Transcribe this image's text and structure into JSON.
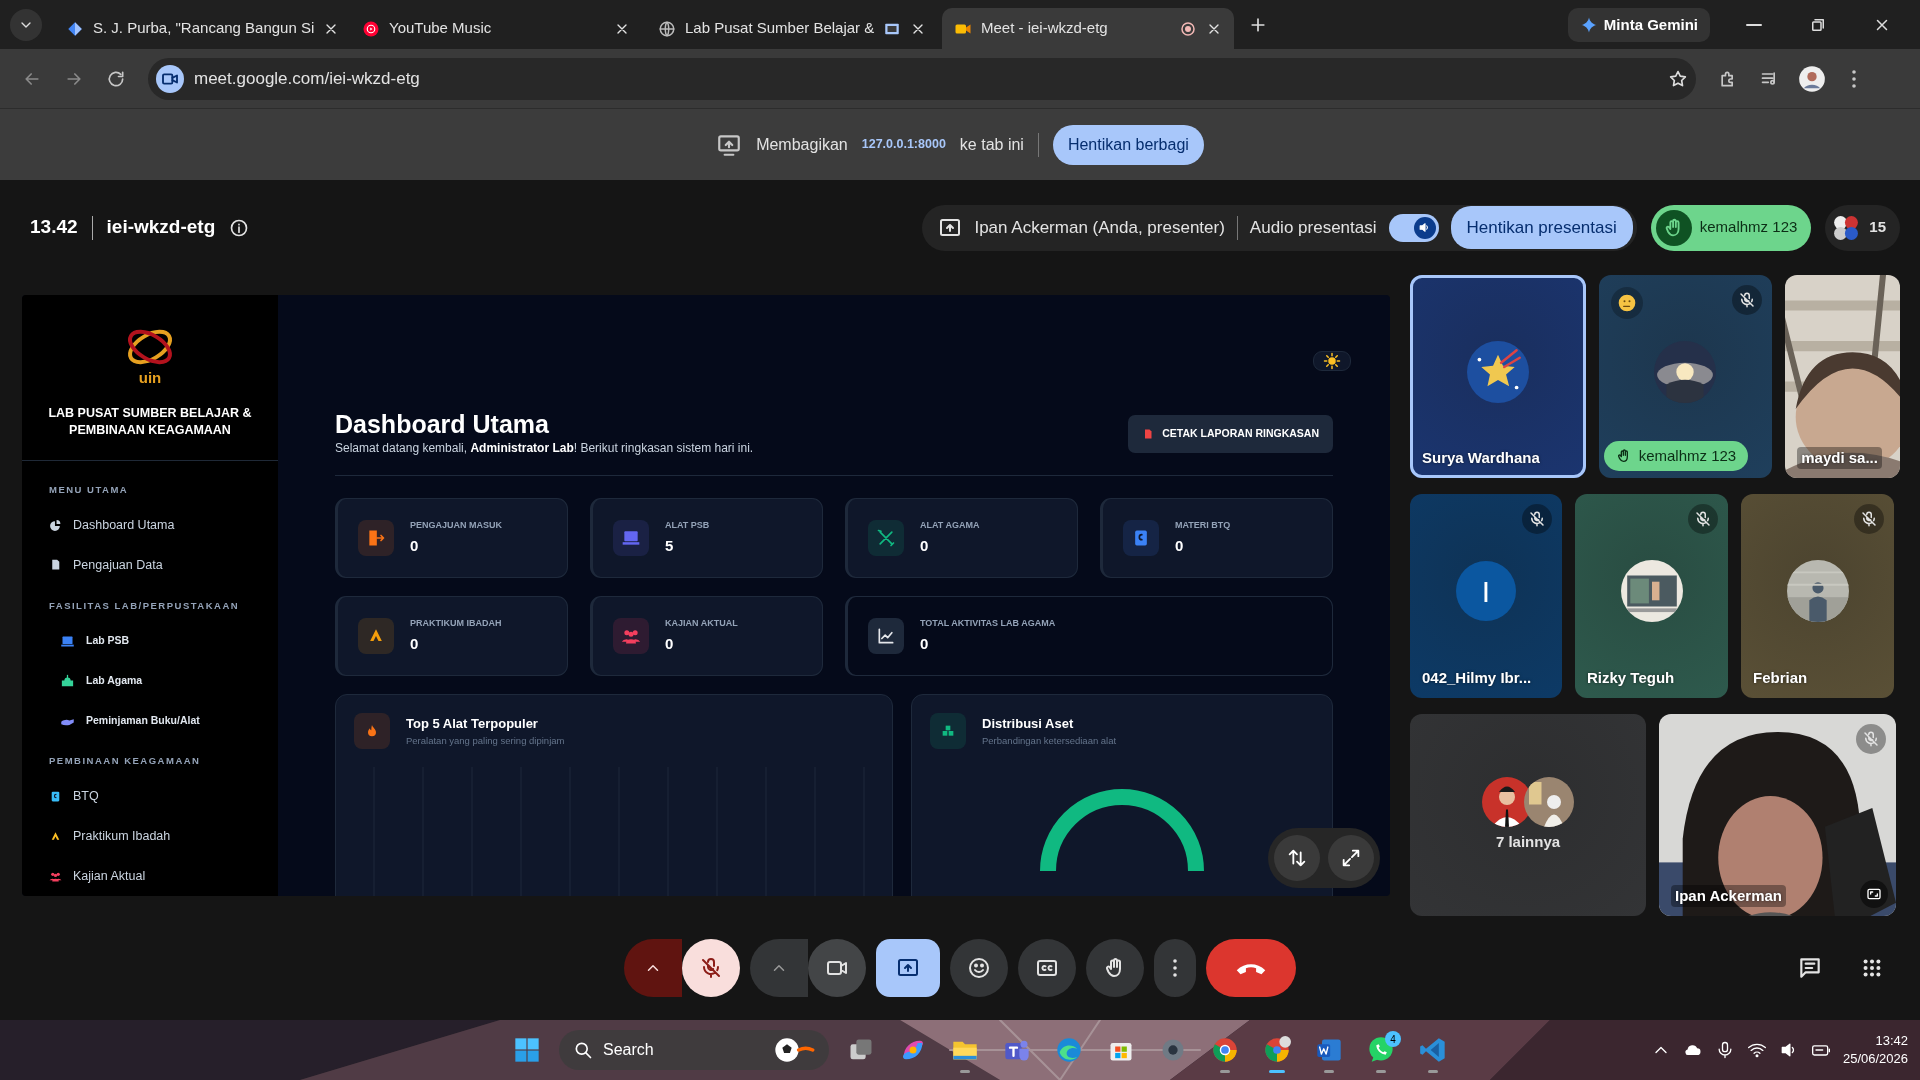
{
  "browser": {
    "tabs": [
      {
        "title": "S. J. Purba, \"Rancang Bangun Si",
        "kind": "doc",
        "selected": false,
        "being_shared": false,
        "recording": false
      },
      {
        "title": "YouTube Music",
        "kind": "music",
        "selected": false,
        "being_shared": false,
        "recording": false
      },
      {
        "title": "Lab Pusat Sumber Belajar &",
        "kind": "web",
        "selected": false,
        "being_shared": true,
        "recording": false
      },
      {
        "title": "Meet - iei-wkzd-etg",
        "kind": "meet",
        "selected": true,
        "being_shared": false,
        "recording": true
      }
    ],
    "gemini_button": "Minta Gemini",
    "address": "meet.google.com/iei-wkzd-etg"
  },
  "share_banner": {
    "label": "Membagikan",
    "origin": "127.0.0.1:8000",
    "suffix": "ke tab ini",
    "button": "Hentikan berbagi"
  },
  "meeting": {
    "time": "13.42",
    "code": "iei-wkzd-etg",
    "presenter": "Ipan Ackerman (Anda, presenter)",
    "audio_label": "Audio presentasi",
    "audio_on": true,
    "stop_button": "Hentikan presentasi",
    "raised_hand": "kemalhmz 123",
    "participant_count": "15"
  },
  "shared_screen": {
    "sidebar": {
      "logo_text": "uin",
      "brand": "LAB PUSAT SUMBER BELAJAR & PEMBINAAN KEAGAMAAN",
      "sections": [
        {
          "title": "MENU UTAMA",
          "items": [
            {
              "label": "Dashboard Utama",
              "kind": "main",
              "color": "#cbd5e1"
            },
            {
              "label": "Pengajuan Data",
              "kind": "main",
              "color": "#cbd5e1"
            }
          ]
        },
        {
          "title": "FASILITAS LAB/PERPUSTAKAAN",
          "items": [
            {
              "label": "Lab PSB",
              "kind": "sub",
              "color": "#3b82f6"
            },
            {
              "label": "Lab Agama",
              "kind": "sub",
              "color": "#34d399"
            },
            {
              "label": "Peminjaman Buku/Alat",
              "kind": "sub",
              "color": "#818cf8"
            }
          ]
        },
        {
          "title": "PEMBINAAN KEAGAMAAN",
          "items": [
            {
              "label": "BTQ",
              "kind": "main",
              "color": "#38bdf8"
            },
            {
              "label": "Praktikum Ibadah",
              "kind": "main",
              "color": "#fbbf24"
            },
            {
              "label": "Kajian Aktual",
              "kind": "main",
              "color": "#f43f5e"
            }
          ]
        }
      ]
    },
    "dashboard": {
      "title": "Dashboard Utama",
      "subtitle": "Selamat datang kembali, **Administrator Lab**! Berikut ringkasan sistem hari ini.",
      "print_button": "CETAK LAPORAN RINGKASAN",
      "stats": [
        {
          "label": "PENGAJUAN MASUK",
          "value": "0",
          "kind": "small",
          "color": "#f97316"
        },
        {
          "label": "ALAT PSB",
          "value": "5",
          "kind": "small",
          "color": "#6366f1"
        },
        {
          "label": "ALAT AGAMA",
          "value": "0",
          "kind": "small",
          "color": "#10b981"
        },
        {
          "label": "MATERI BTQ",
          "value": "0",
          "kind": "small",
          "color": "#3b82f6"
        },
        {
          "label": "PRAKTIKUM IBADAH",
          "value": "0",
          "kind": "small",
          "color": "#f59e0b"
        },
        {
          "label": "KAJIAN AKTUAL",
          "value": "0",
          "kind": "small",
          "color": "#f43f5e"
        },
        {
          "label": "TOTAL AKTIVITAS LAB AGAMA",
          "value": "0",
          "kind": "wide",
          "color": "#e5e7eb"
        }
      ],
      "panels": [
        {
          "title": "Top 5 Alat Terpopuler",
          "subtitle": "Peralatan yang paling sering dipinjam",
          "kind": "bar",
          "color": "#f97316"
        },
        {
          "title": "Distribusi Aset",
          "subtitle": "Perbandingan ketersediaan alat",
          "kind": "donut",
          "color": "#10b981"
        }
      ]
    }
  },
  "tiles": [
    {
      "name": "Surya Wardhana",
      "kind": "avatar",
      "speaking": true,
      "muted": false,
      "hand_raised": false,
      "reaction": false,
      "color": "#1b3570"
    },
    {
      "name": "kemalhmz 123",
      "kind": "avatar",
      "speaking": false,
      "muted": true,
      "hand_raised": true,
      "reaction": true,
      "color": "#1f3f5c"
    },
    {
      "name": "maydi sa...",
      "kind": "video"
    },
    {
      "name": "042_Hilmy Ibr...",
      "kind": "initial",
      "initial": "I",
      "speaking": false,
      "muted": true,
      "hand_raised": false,
      "reaction": false,
      "color": "#0d3a66"
    },
    {
      "name": "Rizky Teguh",
      "kind": "avatar",
      "speaking": false,
      "muted": true,
      "hand_raised": false,
      "reaction": false,
      "color": "#2e5a4d"
    },
    {
      "name": "Febrian",
      "kind": "avatar",
      "speaking": false,
      "muted": true,
      "hand_raised": false,
      "reaction": false,
      "color": "#5a5036"
    },
    {
      "name": "7 lainnya",
      "kind": "more",
      "color": "#333436"
    },
    {
      "name": "Ipan Ackerman",
      "kind": "self_video",
      "muted": true
    }
  ],
  "controls": [
    {
      "kind": "mic",
      "active": true
    },
    {
      "kind": "camera",
      "active": false
    },
    {
      "kind": "present",
      "active": true
    },
    {
      "kind": "reactions",
      "active": false
    },
    {
      "kind": "captions",
      "active": false
    },
    {
      "kind": "hand",
      "active": false
    },
    {
      "kind": "more",
      "active": false
    },
    {
      "kind": "leave",
      "active": false
    }
  ],
  "side_controls": [
    {
      "kind": "chat"
    },
    {
      "kind": "apps"
    }
  ],
  "taskbar": {
    "search": "Search",
    "whatsapp_badge": "4",
    "time": "13:42",
    "date": "25/06/2026"
  }
}
